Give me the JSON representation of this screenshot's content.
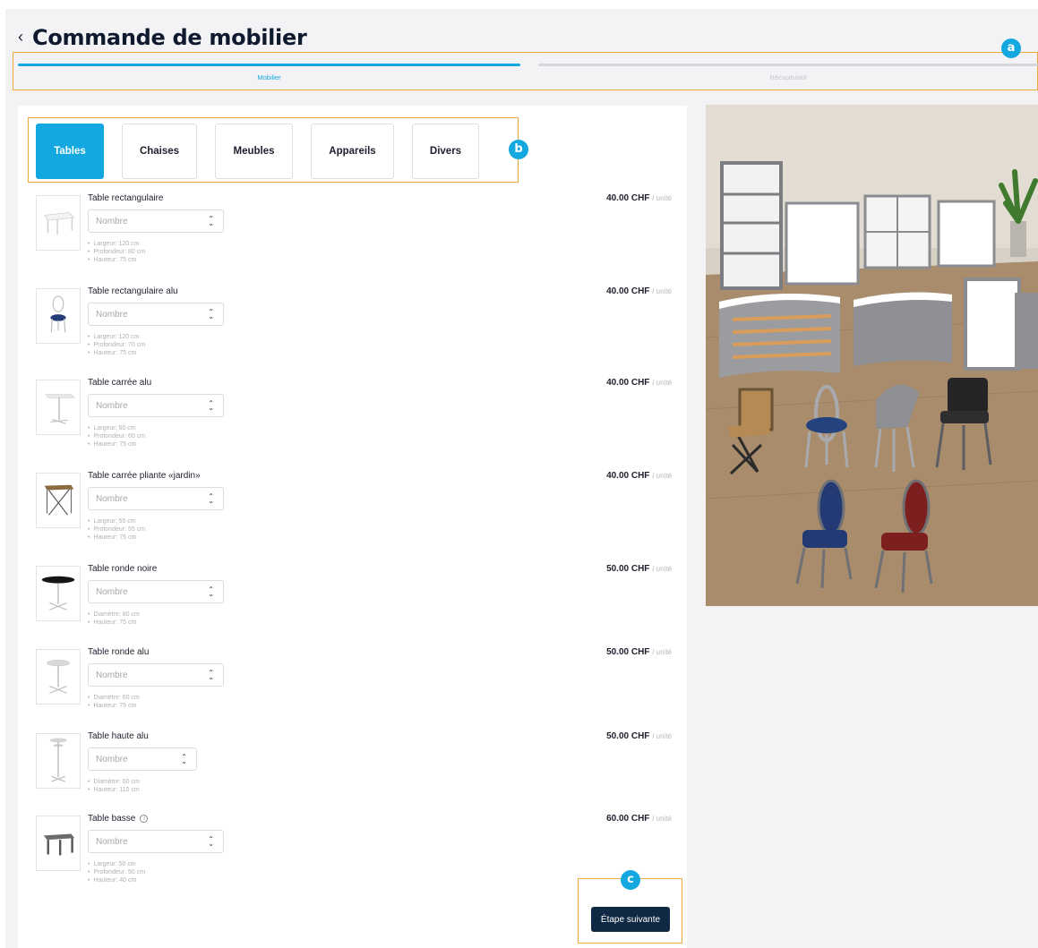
{
  "page": {
    "title": "Commande de mobilier"
  },
  "stepper": {
    "steps": [
      "Mobilier",
      "Récapitulatif"
    ]
  },
  "annotations": {
    "a": "a",
    "b": "b",
    "c": "c"
  },
  "tabs": [
    "Tables",
    "Chaises",
    "Meubles",
    "Appareils",
    "Divers"
  ],
  "quantity_placeholder": "Nombre",
  "products": [
    {
      "name": "Table rectangulaire",
      "price": "40.00 CHF",
      "unit": "/ unité",
      "specs": [
        "Largeur: 120 cm",
        "Profondeur: 80 cm",
        "Hauteur: 75 cm"
      ]
    },
    {
      "name": "Table rectangulaire alu",
      "price": "40.00 CHF",
      "unit": "/ unité",
      "specs": [
        "Largeur: 120 cm",
        "Profondeur: 70 cm",
        "Hauteur: 75 cm"
      ]
    },
    {
      "name": "Table carrée alu",
      "price": "40.00 CHF",
      "unit": "/ unité",
      "specs": [
        "Largeur: 60 cm",
        "Profondeur: 60 cm",
        "Hauteur: 75 cm"
      ]
    },
    {
      "name": "Table carrée pliante «jardin»",
      "price": "40.00 CHF",
      "unit": "/ unité",
      "specs": [
        "Largeur: 55 cm",
        "Profondeur: 55 cm",
        "Hauteur: 75 cm"
      ]
    },
    {
      "name": "Table ronde noire",
      "price": "50.00 CHF",
      "unit": "/ unité",
      "specs": [
        "Diamètre: 80 cm",
        "Hauteur: 75 cm"
      ]
    },
    {
      "name": "Table ronde alu",
      "price": "50.00 CHF",
      "unit": "/ unité",
      "specs": [
        "Diamètre: 60 cm",
        "Hauteur: 75 cm"
      ]
    },
    {
      "name": "Table haute alu",
      "price": "50.00 CHF",
      "unit": "/ unité",
      "specs": [
        "Diamètre: 60 cm",
        "Hauteur: 110 cm"
      ]
    },
    {
      "name": "Table basse",
      "price": "60.00 CHF",
      "unit": "/ unité",
      "specs": [
        "Largeur: 50 cm",
        "Profondeur: 50 cm",
        "Hauteur: 40 cm"
      ]
    }
  ],
  "next_button": "Étape suivante",
  "colors": {
    "accent": "#14a8e0",
    "primary_dark": "#0f2843",
    "annotation": "#f0a83a"
  }
}
